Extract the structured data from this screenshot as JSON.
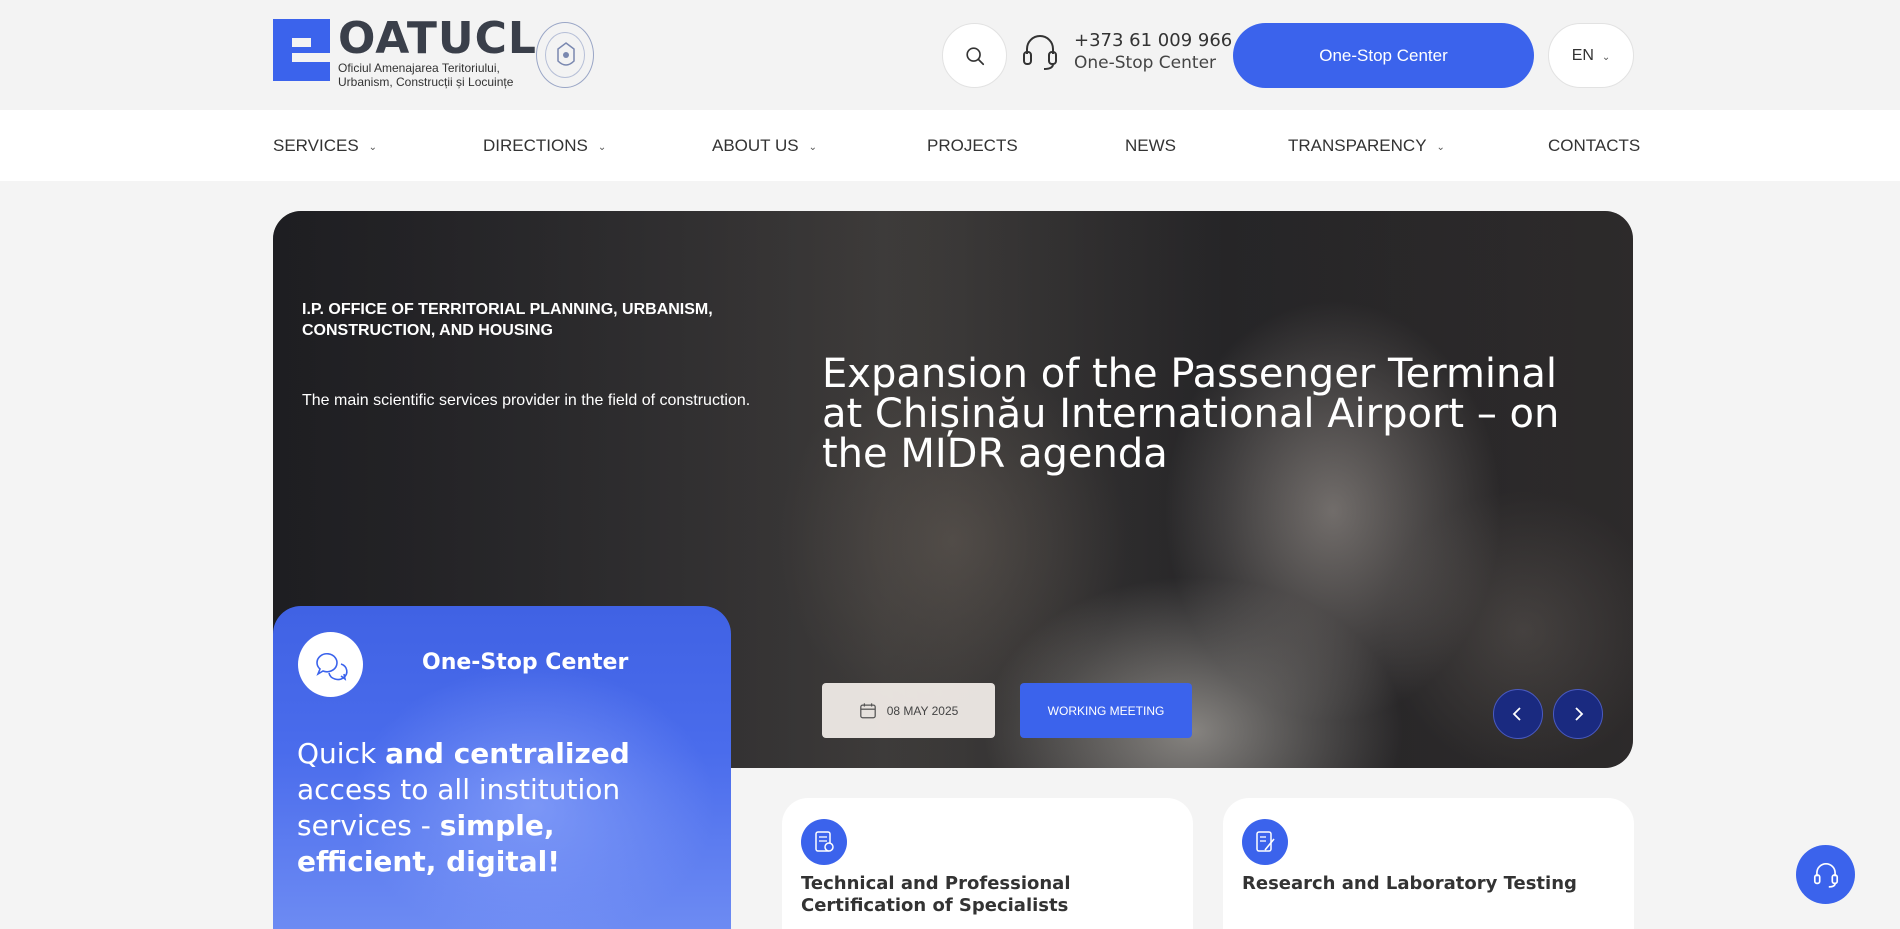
{
  "header": {
    "logo_title": "OATUCL",
    "logo_subtitle_line1": "Oficiul Amenajarea Teritoriului,",
    "logo_subtitle_line2": "Urbanism, Construcții și Locuințe",
    "phone_number": "+373 61 009 966",
    "phone_label": "One-Stop Center",
    "cta_label": "One-Stop Center",
    "language": "EN"
  },
  "nav": {
    "items": [
      {
        "label": "SERVICES",
        "has_dropdown": true
      },
      {
        "label": "DIRECTIONS",
        "has_dropdown": true
      },
      {
        "label": "ABOUT US",
        "has_dropdown": true
      },
      {
        "label": "PROJECTS",
        "has_dropdown": false
      },
      {
        "label": "NEWS",
        "has_dropdown": false
      },
      {
        "label": "TRANSPARENCY",
        "has_dropdown": true
      },
      {
        "label": "CONTACTS",
        "has_dropdown": false
      }
    ]
  },
  "hero": {
    "org_label": "I.P. OFFICE OF TERRITORIAL PLANNING, URBANISM, CONSTRUCTION, AND HOUSING",
    "description": "The main scientific services provider in the field of construction.",
    "headline": "Expansion of the Passenger Terminal at Chișinău International Airport – on the MIDR agenda",
    "date": "08 MAY 2025",
    "tag": "WORKING MEETING"
  },
  "one_stop": {
    "title": "One-Stop Center",
    "text_parts": [
      {
        "text": "Quick ",
        "bold": false
      },
      {
        "text": "and centralized",
        "bold": true
      },
      {
        "text": " access to all institution services - ",
        "bold": false
      },
      {
        "text": "simple, efficient, digital!",
        "bold": true
      }
    ]
  },
  "services": [
    {
      "title": "Technical and Professional Certification of Specialists",
      "icon": "certificate-icon"
    },
    {
      "title": "Research and Laboratory Testing",
      "icon": "lab-document-icon"
    }
  ],
  "colors": {
    "accent": "#3b63ec",
    "nav_dark": "#1a2a80",
    "text_dark": "#333333"
  }
}
